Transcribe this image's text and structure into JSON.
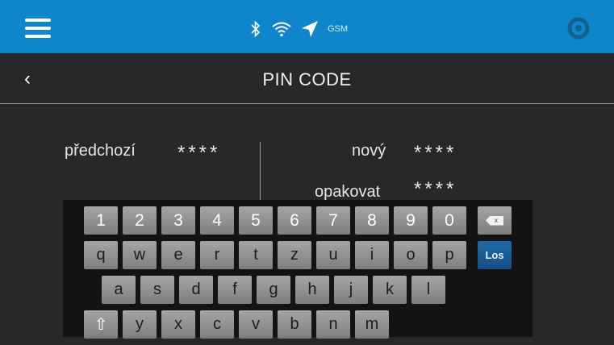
{
  "status_bar": {
    "gsm_label": "GSM"
  },
  "header": {
    "title": "PIN CODE",
    "back_icon": "‹"
  },
  "pin": {
    "previous_label": "předchozí",
    "previous_value": "****",
    "new_label": "nový",
    "new_value": "****",
    "repeat_label": "opakovat",
    "repeat_value": "****"
  },
  "keyboard": {
    "row1": [
      "1",
      "2",
      "3",
      "4",
      "5",
      "6",
      "7",
      "8",
      "9",
      "0"
    ],
    "row2": [
      "q",
      "w",
      "e",
      "r",
      "t",
      "z",
      "u",
      "i",
      "o",
      "p"
    ],
    "row3": [
      "a",
      "s",
      "d",
      "f",
      "g",
      "h",
      "j",
      "k",
      "l"
    ],
    "row4": [
      "y",
      "x",
      "c",
      "v",
      "b",
      "n",
      "m"
    ],
    "backspace_text": "x",
    "shift_glyph": "⇧",
    "enter_label": "Los"
  },
  "colors": {
    "top_bar": "#0f86cc",
    "background": "#282828",
    "key": "#939393",
    "enter_key": "#1a5d96"
  }
}
